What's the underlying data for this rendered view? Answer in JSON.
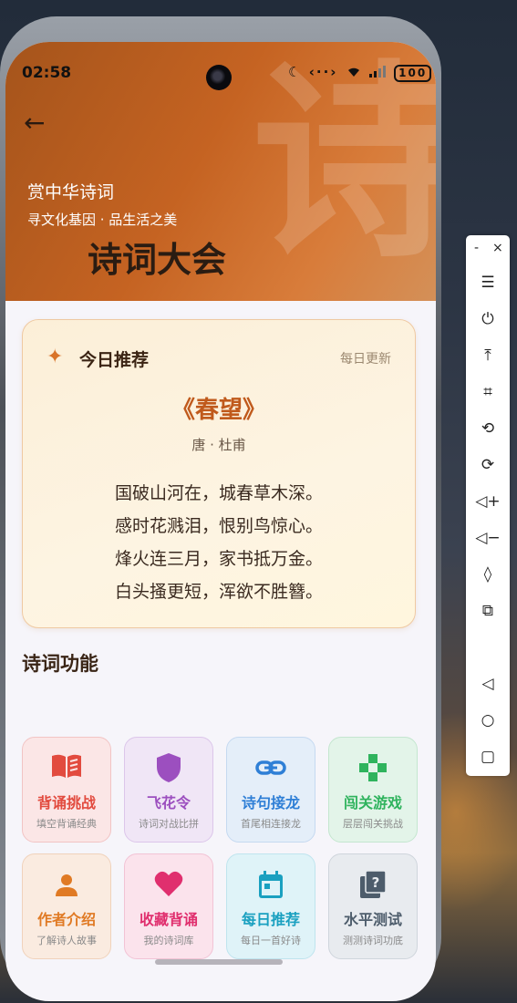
{
  "status": {
    "time": "02:58",
    "icons": "☾ ‹⋯› ◔ ░",
    "battery": "100"
  },
  "header": {
    "back_icon": "←",
    "bg_char": "诗",
    "subtitle": "赏中华诗词",
    "tagline": "寻文化基因 · 品生活之美",
    "title": "诗词大会"
  },
  "recommend": {
    "icon": "✦",
    "title": "今日推荐",
    "update": "每日更新",
    "poem_title": "《春望》",
    "author": "唐 · 杜甫",
    "lines": [
      "国破山河在，城春草木深。",
      "感时花溅泪，恨别鸟惊心。",
      "烽火连三月，家书抵万金。",
      "白头搔更短，浑欲不胜簪。"
    ]
  },
  "features": {
    "title": "诗词功能",
    "items": [
      {
        "label": "背诵挑战",
        "desc": "填空背诵经典",
        "icon": "book-icon",
        "color": "#e24b3f",
        "bg": "#fbe6e6",
        "border": "#f2c4c4"
      },
      {
        "label": "飞花令",
        "desc": "诗词对战比拼",
        "icon": "shield-icon",
        "color": "#9c4fbf",
        "bg": "#f0e6f6",
        "border": "#dcc6ea"
      },
      {
        "label": "诗句接龙",
        "desc": "首尾相连接龙",
        "icon": "link-icon",
        "color": "#2f7fd6",
        "bg": "#e4eef9",
        "border": "#c5d9f0"
      },
      {
        "label": "闯关游戏",
        "desc": "层层闯关挑战",
        "icon": "gamepad-icon",
        "color": "#2fb35d",
        "bg": "#e3f4e9",
        "border": "#c4e6cf"
      },
      {
        "label": "作者介绍",
        "desc": "了解诗人故事",
        "icon": "person-icon",
        "color": "#e07a24",
        "bg": "#faebe0",
        "border": "#f0d2bb"
      },
      {
        "label": "收藏背诵",
        "desc": "我的诗词库",
        "icon": "heart-icon",
        "color": "#e02f6e",
        "bg": "#fbe3ec",
        "border": "#f2c3d5"
      },
      {
        "label": "每日推荐",
        "desc": "每日一首好诗",
        "icon": "calendar-icon",
        "color": "#1aa0c0",
        "bg": "#dff3f8",
        "border": "#bfe4ee"
      },
      {
        "label": "水平测试",
        "desc": "测测诗词功底",
        "icon": "quiz-icon",
        "color": "#4d5c6b",
        "bg": "#e8ebef",
        "border": "#cfd5dc"
      }
    ]
  },
  "floatbar": {
    "minimize": "-",
    "close": "×"
  }
}
